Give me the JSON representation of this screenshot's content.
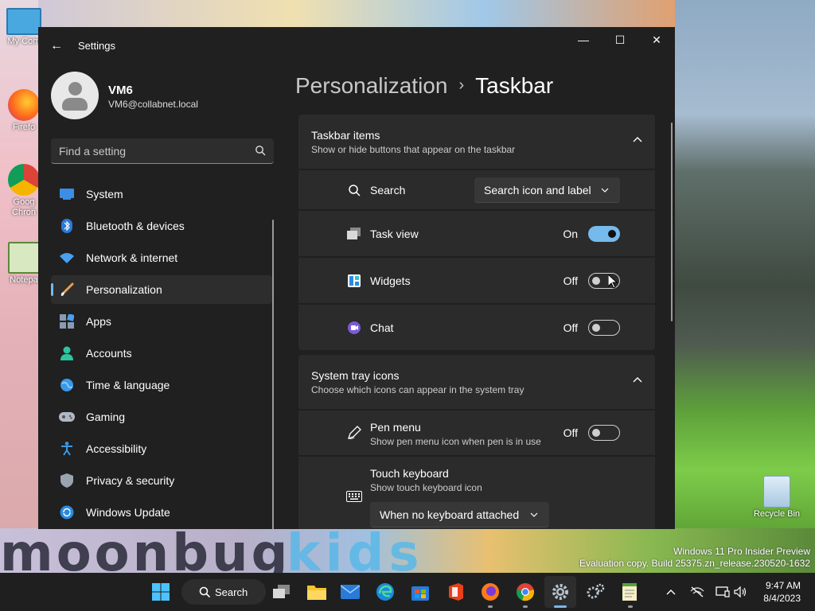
{
  "desktop": {
    "icons": [
      {
        "label": "My Com"
      },
      {
        "label": "Firefo"
      },
      {
        "label": "Goog Chron"
      },
      {
        "label": "Notepa"
      }
    ],
    "recycle_bin": "Recycle Bin",
    "wallpaper_text_1": "moonbug",
    "wallpaper_text_2": "kids",
    "watermark_line1": "Windows 11 Pro Insider Preview",
    "watermark_line2": "Evaluation copy. Build 25375.zn_release.230520-1632"
  },
  "window": {
    "app_title": "Settings",
    "back_label": "←",
    "controls": {
      "minimize": "—",
      "maximize": "☐",
      "close": "✕"
    }
  },
  "user": {
    "name": "VM6",
    "email": "VM6@collabnet.local"
  },
  "search": {
    "placeholder": "Find a setting"
  },
  "nav": {
    "items": [
      {
        "label": "System",
        "icon": "system-icon"
      },
      {
        "label": "Bluetooth & devices",
        "icon": "bluetooth-icon"
      },
      {
        "label": "Network & internet",
        "icon": "wifi-icon"
      },
      {
        "label": "Personalization",
        "icon": "brush-icon",
        "active": true
      },
      {
        "label": "Apps",
        "icon": "apps-icon"
      },
      {
        "label": "Accounts",
        "icon": "accounts-icon"
      },
      {
        "label": "Time & language",
        "icon": "globe-icon"
      },
      {
        "label": "Gaming",
        "icon": "gamepad-icon"
      },
      {
        "label": "Accessibility",
        "icon": "accessibility-icon"
      },
      {
        "label": "Privacy & security",
        "icon": "shield-icon"
      },
      {
        "label": "Windows Update",
        "icon": "update-icon"
      }
    ]
  },
  "breadcrumb": {
    "parent": "Personalization",
    "separator": "›",
    "current": "Taskbar"
  },
  "taskbar_items": {
    "title": "Taskbar items",
    "subtitle": "Show or hide buttons that appear on the taskbar",
    "rows": {
      "search": {
        "label": "Search",
        "value": "Search icon and label"
      },
      "task_view": {
        "label": "Task view",
        "state": "On"
      },
      "widgets": {
        "label": "Widgets",
        "state": "Off"
      },
      "chat": {
        "label": "Chat",
        "state": "Off"
      }
    }
  },
  "system_tray_icons": {
    "title": "System tray icons",
    "subtitle": "Choose which icons can appear in the system tray",
    "rows": {
      "pen_menu": {
        "label": "Pen menu",
        "sub": "Show pen menu icon when pen is in use",
        "state": "Off"
      },
      "touch_keyboard": {
        "label": "Touch keyboard",
        "sub": "Show touch keyboard icon",
        "value": "When no keyboard attached"
      }
    }
  },
  "taskbar": {
    "search_label": "Search",
    "time": "9:47 AM",
    "date": "8/4/2023"
  },
  "colors": {
    "accent": "#76b9ed",
    "window_bg": "#202020",
    "card_bg": "#2b2b2b"
  }
}
